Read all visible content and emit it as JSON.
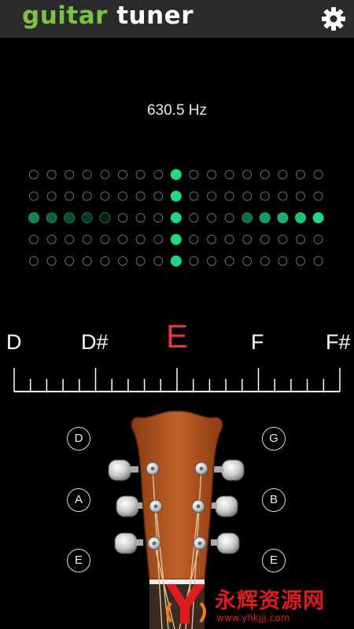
{
  "header": {
    "title_word1": "guitar",
    "title_word2": "tuner",
    "settings_icon": "gear-icon"
  },
  "frequency": {
    "display": "630.5 Hz"
  },
  "meter": {
    "rows": [
      [
        0,
        0,
        0,
        0,
        0,
        0,
        0,
        0,
        1,
        0,
        0,
        0,
        0,
        0,
        0,
        0,
        0
      ],
      [
        0,
        0,
        0,
        0,
        0,
        0,
        0,
        0,
        1,
        0,
        0,
        0,
        0,
        0,
        0,
        0,
        0
      ],
      [
        0.6,
        0.45,
        0.35,
        0.25,
        0.15,
        0,
        0,
        0,
        1,
        0,
        0,
        0,
        0.5,
        0.7,
        0.8,
        0.9,
        1
      ],
      [
        0,
        0,
        0,
        0,
        0,
        0,
        0,
        0,
        1,
        0,
        0,
        0,
        0,
        0,
        0,
        0,
        0
      ],
      [
        0,
        0,
        0,
        0,
        0,
        0,
        0,
        0,
        1,
        0,
        0,
        0,
        0,
        0,
        0,
        0,
        0
      ]
    ],
    "active_color": "#1fd882",
    "inactive_color": "#6b6b6b"
  },
  "notes": {
    "left_far": "D",
    "left_near": "D#",
    "current": "E",
    "right_near": "F",
    "right_far": "F#",
    "current_color": "#e03b3b"
  },
  "strings": {
    "left": [
      "D",
      "A",
      "E"
    ],
    "right": [
      "G",
      "B",
      "E"
    ]
  },
  "watermark": {
    "text": "永辉资源网",
    "url": "www.yhkjjj.com"
  }
}
